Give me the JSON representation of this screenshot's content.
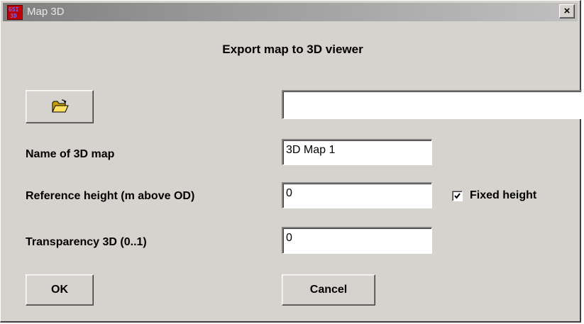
{
  "window": {
    "title": "Map 3D",
    "close_label": "×",
    "icon": "gsi-3d-app-icon",
    "icon_text_top": "GSI",
    "icon_text_bottom": "3D"
  },
  "dialog": {
    "heading": "Export map to 3D viewer",
    "browse_button_icon": "open-folder-icon",
    "file_path_value": "",
    "map_name_label": "Name of 3D map",
    "map_name_value": "3D Map 1",
    "ref_height_label": "Reference height (m above OD)",
    "ref_height_value": "0",
    "fixed_height_label": "Fixed height",
    "fixed_height_checked": true,
    "transparency_label": "Transparency 3D (0..1)",
    "transparency_value": "0",
    "ok_label": "OK",
    "cancel_label": "Cancel"
  },
  "colors": {
    "dialog_bg": "#d6d3ce",
    "titlebar_inactive": "#9e9e9e",
    "icon_red": "#c00000"
  }
}
